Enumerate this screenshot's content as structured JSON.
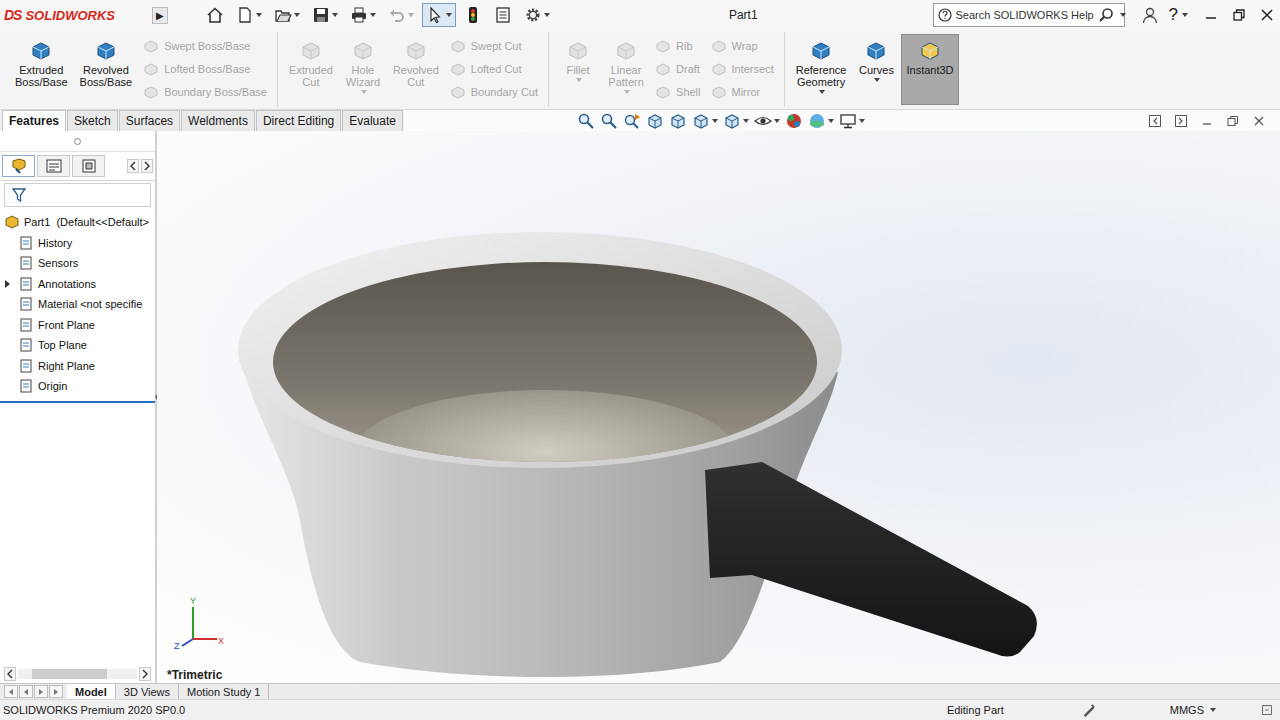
{
  "app": {
    "mark": "DS",
    "name": "SOLIDWORKS",
    "flyout": "▶"
  },
  "window": {
    "title": "Part1"
  },
  "quick_access": {
    "select_active": true
  },
  "search": {
    "placeholder": "Search SOLIDWORKS Help"
  },
  "help": "?",
  "ribbon": [
    {
      "tools": [
        {
          "kind": "large",
          "label": "Extruded Boss/Base",
          "disabled": false,
          "selected": false,
          "dropdown": false
        },
        {
          "kind": "large",
          "label": "Revolved Boss/Base",
          "disabled": false,
          "selected": false,
          "dropdown": false
        },
        {
          "kind": "stack",
          "items": [
            {
              "label": "Swept Boss/Base",
              "disabled": true
            },
            {
              "label": "Lofted Boss/Base",
              "disabled": true
            },
            {
              "label": "Boundary Boss/Base",
              "disabled": true
            }
          ]
        }
      ]
    },
    {
      "tools": [
        {
          "kind": "large",
          "label": "Extruded Cut",
          "disabled": true,
          "selected": false,
          "dropdown": false
        },
        {
          "kind": "large",
          "label": "Hole Wizard",
          "disabled": true,
          "selected": false,
          "dropdown": true
        },
        {
          "kind": "large",
          "label": "Revolved Cut",
          "disabled": true,
          "selected": false,
          "dropdown": false
        },
        {
          "kind": "stack",
          "items": [
            {
              "label": "Swept Cut",
              "disabled": true
            },
            {
              "label": "Lofted Cut",
              "disabled": true
            },
            {
              "label": "Boundary Cut",
              "disabled": true
            }
          ]
        }
      ]
    },
    {
      "tools": [
        {
          "kind": "large",
          "label": "Fillet",
          "disabled": true,
          "selected": false,
          "dropdown": true
        },
        {
          "kind": "large",
          "label": "Linear Pattern",
          "disabled": true,
          "selected": false,
          "dropdown": true
        },
        {
          "kind": "stack",
          "items": [
            {
              "label": "Rib",
              "disabled": true
            },
            {
              "label": "Draft",
              "disabled": true
            },
            {
              "label": "Shell",
              "disabled": true
            }
          ]
        },
        {
          "kind": "stack",
          "items": [
            {
              "label": "Wrap",
              "disabled": true
            },
            {
              "label": "Intersect",
              "disabled": true
            },
            {
              "label": "Mirror",
              "disabled": true
            }
          ]
        }
      ]
    },
    {
      "tools": [
        {
          "kind": "large",
          "label": "Reference Geometry",
          "disabled": false,
          "selected": false,
          "dropdown": true
        },
        {
          "kind": "large",
          "label": "Curves",
          "disabled": false,
          "selected": false,
          "dropdown": true
        },
        {
          "kind": "large",
          "label": "Instant3D",
          "disabled": false,
          "selected": true,
          "dropdown": false
        }
      ]
    }
  ],
  "tabs": [
    {
      "label": "Features",
      "selected": true
    },
    {
      "label": "Sketch",
      "selected": false
    },
    {
      "label": "Surfaces",
      "selected": false
    },
    {
      "label": "Weldments",
      "selected": false
    },
    {
      "label": "Direct Editing",
      "selected": false
    },
    {
      "label": "Evaluate",
      "selected": false
    }
  ],
  "panel_tabs": [
    {
      "selected": true
    },
    {
      "selected": false
    },
    {
      "selected": false
    }
  ],
  "tree": {
    "root": "Part1  (Default<<Default>",
    "items": [
      {
        "label": "History",
        "expandable": false
      },
      {
        "label": "Sensors",
        "expandable": false
      },
      {
        "label": "Annotations",
        "expandable": true
      },
      {
        "label": "Material <not specifie",
        "expandable": false
      },
      {
        "label": "Front Plane",
        "expandable": false
      },
      {
        "label": "Top Plane",
        "expandable": false
      },
      {
        "label": "Right Plane",
        "expandable": false
      },
      {
        "label": "Origin",
        "expandable": false
      }
    ]
  },
  "view": {
    "orientation": "*Trimetric",
    "axes": {
      "y": "Y",
      "x": "X",
      "z": "Z"
    }
  },
  "bottom_tabs": [
    {
      "label": "Model",
      "selected": true
    },
    {
      "label": "3D Views",
      "selected": false
    },
    {
      "label": "Motion Study 1",
      "selected": false
    }
  ],
  "status_bar": {
    "product": "SOLIDWORKS Premium 2020 SP0.0",
    "mode": "Editing Part",
    "units": "MMGS"
  }
}
